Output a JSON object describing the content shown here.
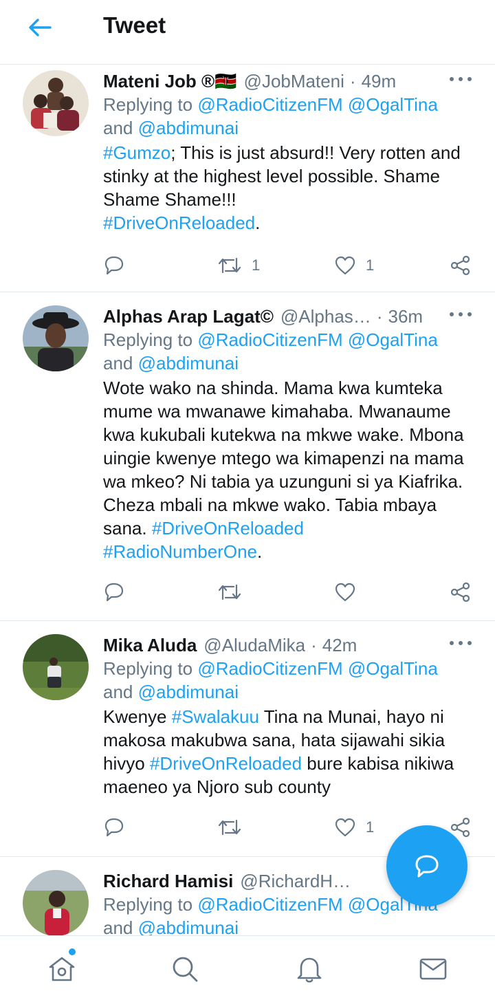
{
  "header": {
    "title": "Tweet",
    "back_icon": "arrow-left-icon"
  },
  "tweets": [
    {
      "name": "Mateni Job ®🇰🇪",
      "handle": "@JobMateni",
      "time": "49m",
      "reply_prefix": "Replying to",
      "reply_mentions": "@RadioCitizenFM @OgalTina",
      "reply_and": "and",
      "reply_last": "@abdimunai",
      "body": [
        {
          "t": "tag",
          "v": "#Gumzo"
        },
        {
          "t": "text",
          "v": "; This is just absurd!! Very rotten and stinky at the highest level possible. Shame Shame Shame!!!"
        },
        {
          "t": "br",
          "v": ""
        },
        {
          "t": "tag",
          "v": "#DriveOnReloaded"
        },
        {
          "t": "text",
          "v": "."
        }
      ],
      "retweets": "1",
      "likes": "1"
    },
    {
      "name": "Alphas Arap Lagat©",
      "handle": "@Alphas…",
      "time": "36m",
      "reply_prefix": "Replying to",
      "reply_mentions": "@RadioCitizenFM @OgalTina",
      "reply_and": "and",
      "reply_last": "@abdimunai",
      "body": [
        {
          "t": "text",
          "v": "Wote wako na shinda. Mama kwa kumteka mume wa mwanawe kimahaba. Mwanaume kwa kukubali kutekwa na mkwe wake. Mbona uingie kwenye mtego wa kimapenzi na mama wa mkeo? Ni tabia ya uzunguni si ya Kiafrika. Cheza mbali na mkwe wako. Tabia mbaya sana. "
        },
        {
          "t": "tag",
          "v": "#DriveOnReloaded"
        },
        {
          "t": "br",
          "v": ""
        },
        {
          "t": "tag",
          "v": "#RadioNumberOne"
        },
        {
          "t": "text",
          "v": "."
        }
      ],
      "retweets": "",
      "likes": ""
    },
    {
      "name": "Mika Aluda",
      "handle": "@AludaMika",
      "time": "42m",
      "reply_prefix": "Replying to",
      "reply_mentions": "@RadioCitizenFM @OgalTina",
      "reply_and": "and",
      "reply_last": "@abdimunai",
      "body": [
        {
          "t": "text",
          "v": "Kwenye "
        },
        {
          "t": "tag",
          "v": "#Swalakuu"
        },
        {
          "t": "text",
          "v": " Tina na Munai, hayo ni makosa makubwa sana, hata sijawahi sikia hivyo "
        },
        {
          "t": "tag",
          "v": "#DriveOnReloaded"
        },
        {
          "t": "text",
          "v": " bure kabisa nikiwa maeneo ya Njoro sub county"
        }
      ],
      "retweets": "",
      "likes": "1"
    },
    {
      "name": "Richard Hamisi",
      "handle": "@RichardHa…",
      "time": "",
      "reply_prefix": "Replying to",
      "reply_mentions": "@RadioCitizenFM @OgalTina",
      "reply_and": "and",
      "reply_last": "@abdimunai",
      "body": [],
      "retweets": "",
      "likes": ""
    }
  ],
  "fab": {
    "icon": "compose-reply-icon"
  },
  "bottom_nav": [
    {
      "name": "home",
      "icon": "home-icon"
    },
    {
      "name": "search",
      "icon": "search-icon"
    },
    {
      "name": "notifications",
      "icon": "bell-icon"
    },
    {
      "name": "messages",
      "icon": "mail-icon"
    }
  ],
  "colors": {
    "accent": "#1da1f2",
    "muted": "#657786",
    "text": "#14171a",
    "divider": "#e1e8ed"
  }
}
